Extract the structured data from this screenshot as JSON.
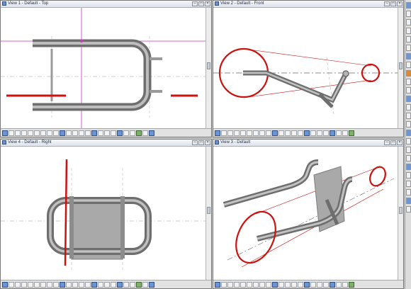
{
  "viewports": {
    "v1": {
      "title": "View 1 - Default - Top"
    },
    "v2": {
      "title": "View 2 - Default - Front"
    },
    "v4": {
      "title": "View 4 - Default - Right"
    },
    "v3": {
      "title": "View 3 - Default"
    }
  },
  "colors": {
    "accent_red": "#cc1111",
    "guide_magenta": "#cc33cc",
    "tube": "#8a8a8a",
    "plate": "#a8a8a8"
  },
  "icons": [
    "minimize-icon",
    "maximize-icon",
    "close-icon",
    "zoom-icon",
    "pan-icon",
    "rotate-icon",
    "fit-icon",
    "render-icon",
    "wireframe-icon"
  ]
}
